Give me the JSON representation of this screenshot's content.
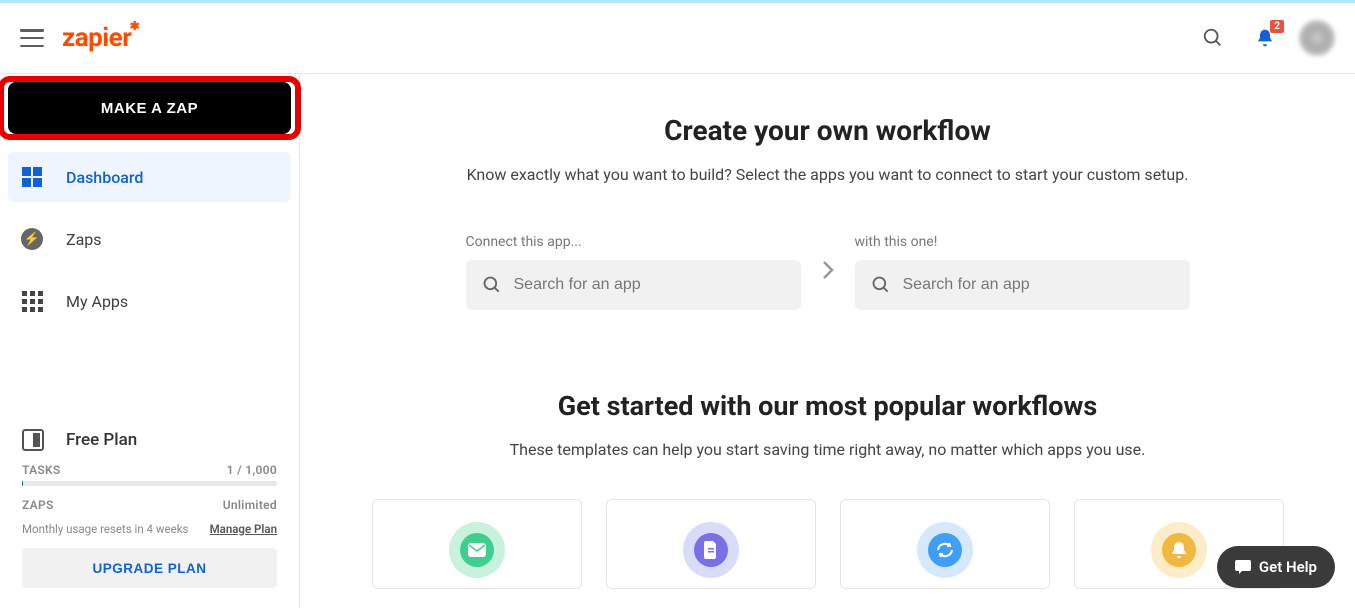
{
  "header": {
    "logo_text": "zapier",
    "notification_count": "2"
  },
  "sidebar": {
    "make_zap_label": "MAKE A ZAP",
    "items": [
      {
        "label": "Dashboard"
      },
      {
        "label": "Zaps"
      },
      {
        "label": "My Apps"
      }
    ],
    "plan": {
      "name": "Free Plan",
      "tasks_label": "TASKS",
      "tasks_value": "1 / 1,000",
      "zaps_label": "ZAPS",
      "zaps_value": "Unlimited",
      "reset_text": "Monthly usage resets in 4 weeks",
      "manage_label": "Manage Plan",
      "upgrade_label": "UPGRADE PLAN"
    }
  },
  "main": {
    "hero_title": "Create your own workflow",
    "hero_sub": "Know exactly what you want to build? Select the apps you want to connect to start your custom setup.",
    "connect_left_label": "Connect this app...",
    "connect_right_label": "with this one!",
    "search_placeholder": "Search for an app",
    "popular_title": "Get started with our most popular workflows",
    "popular_sub": "These templates can help you start saving time right away, no matter which apps you use."
  },
  "help": {
    "label": "Get Help"
  }
}
